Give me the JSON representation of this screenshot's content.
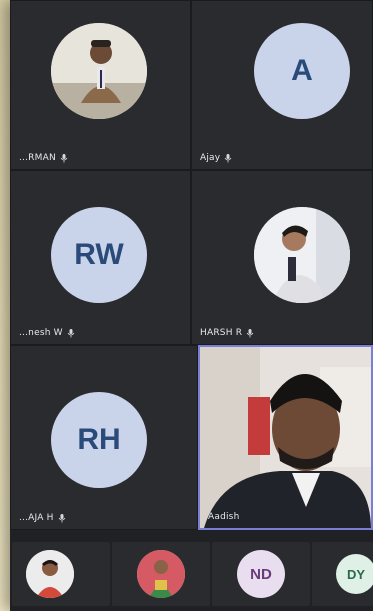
{
  "participants": [
    {
      "name": "...RMAN",
      "type": "photo"
    },
    {
      "name": "Ajay",
      "type": "initials",
      "initials": "A"
    },
    {
      "name": "...nesh W",
      "type": "initials",
      "initials": "RW"
    },
    {
      "name": "HARSH R",
      "type": "photo"
    },
    {
      "name": "...AJA H",
      "type": "initials",
      "initials": "RH"
    },
    {
      "name": "Aadish",
      "type": "video"
    }
  ],
  "strip": [
    {
      "type": "photo"
    },
    {
      "type": "photo"
    },
    {
      "type": "initials",
      "initials": "ND"
    },
    {
      "type": "initials",
      "initials": "DY"
    }
  ],
  "colors": {
    "tile_bg": "#2a2b2e",
    "active_border": "#7a7fd6",
    "avatar_bg": "#c9d3ea",
    "avatar_text": "#2a4a7a"
  }
}
